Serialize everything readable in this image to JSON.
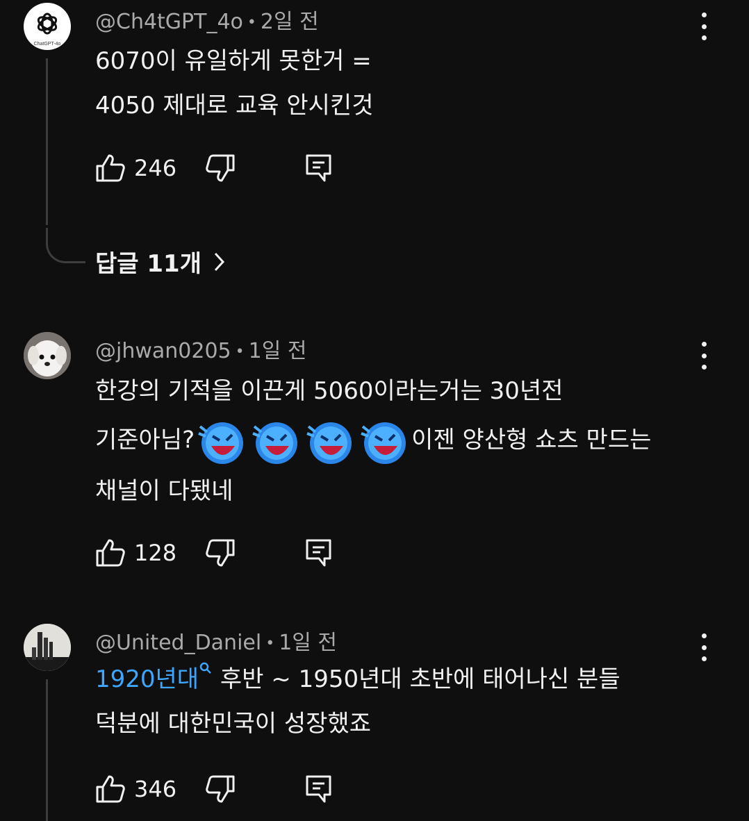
{
  "comments": [
    {
      "author": "@Ch4tGPT_4o",
      "time": "2일 전",
      "avatar_text": "ChatGPT-4o",
      "lines": [
        "6070이 유일하게 못한거 =",
        "4050 제대로 교육 안시킨것"
      ],
      "likes": "246",
      "replies_label": "답글 11개"
    },
    {
      "author": "@jhwan0205",
      "time": "1일 전",
      "line1": "한강의 기적을 이끈게 5060이라는거는 30년전",
      "line2_start": "기준아님?",
      "line2_end": "이젠 양산형 쇼츠 만드는",
      "line3": "채널이 다됐네",
      "likes": "128"
    },
    {
      "author": "@United_Daniel",
      "time": "1일 전",
      "link_text": "1920년대",
      "line1_rest": " 후반 ~ 1950년대 초반에 태어나신 분들",
      "line2": "덕분에 대한민국이 성장했죠",
      "likes": "346"
    }
  ],
  "colors": {
    "background": "#0f0f0f",
    "link": "#3ea6ff",
    "muted": "#aaaaaa"
  }
}
